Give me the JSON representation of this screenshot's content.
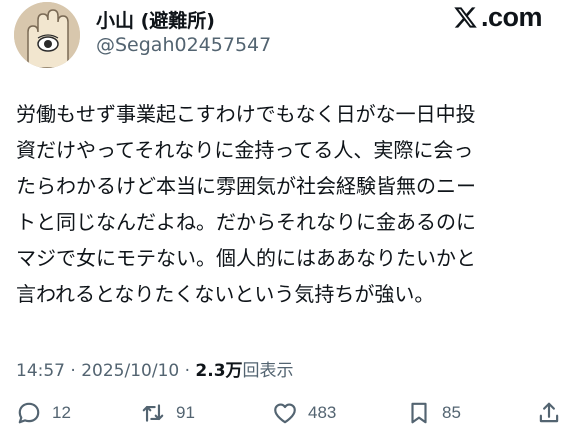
{
  "brand": {
    "suffix": ".com",
    "logo_icon": "x-logo-icon"
  },
  "author": {
    "display_name": "小山 (避難所)",
    "handle": "@Segah02457547",
    "avatar_icon": "cartoon-hand-with-eye-avatar"
  },
  "tweet": {
    "lines": [
      "労働もせず事業起こすわけでもなく日がな一日中投",
      "資だけやってそれなりに金持ってる人、実際に会っ",
      "たらわかるけど本当に雰囲気が社会経験皆無のニー",
      "トと同じなんだよね。だからそれなりに金あるのに",
      "マジで女にモテない。個人的にはああなりたいかと",
      "言われるとなりたくないという気持ちが強い。"
    ]
  },
  "meta": {
    "time": "14:57",
    "separator": "·",
    "date": "2025/10/10",
    "views_count": "2.3万",
    "views_label": "回表示"
  },
  "actions": {
    "reply": {
      "icon": "reply-icon",
      "count": "12"
    },
    "repost": {
      "icon": "repost-icon",
      "count": "91"
    },
    "like": {
      "icon": "heart-icon",
      "count": "483"
    },
    "bookmark": {
      "icon": "bookmark-icon",
      "count": "85"
    },
    "share": {
      "icon": "share-icon"
    }
  },
  "colors": {
    "text_primary": "#0f1419",
    "text_secondary": "#536471",
    "background": "#ffffff"
  }
}
